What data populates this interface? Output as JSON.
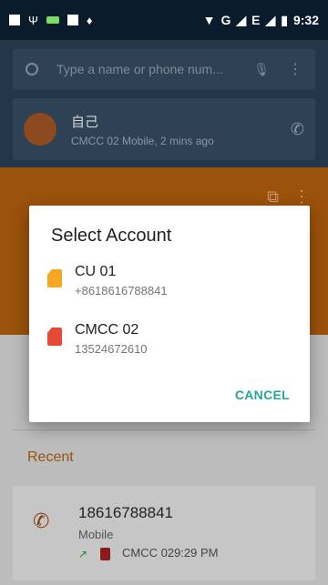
{
  "status_bar": {
    "time": "9:32",
    "network": "G",
    "network2": "E"
  },
  "search": {
    "placeholder": "Type a name or phone num..."
  },
  "recent_card": {
    "name": "自己",
    "detail": "CMCC 02 Mobile, 2 mins ago"
  },
  "dialog": {
    "title": "Select Account",
    "accounts": [
      {
        "name": "CU 01",
        "number": "+8618616788841",
        "sim_color": "#f5a623"
      },
      {
        "name": "CMCC 02",
        "number": "13524672610",
        "sim_color": "#e64a35"
      }
    ],
    "cancel_label": "CANCEL"
  },
  "recent_section": {
    "header": "Recent",
    "items": [
      {
        "number": "18616788841",
        "type": "Mobile",
        "detail": "CMCC 029:29 PM"
      }
    ]
  },
  "colors": {
    "accent": "#26a69a",
    "orange": "#9b520b"
  }
}
